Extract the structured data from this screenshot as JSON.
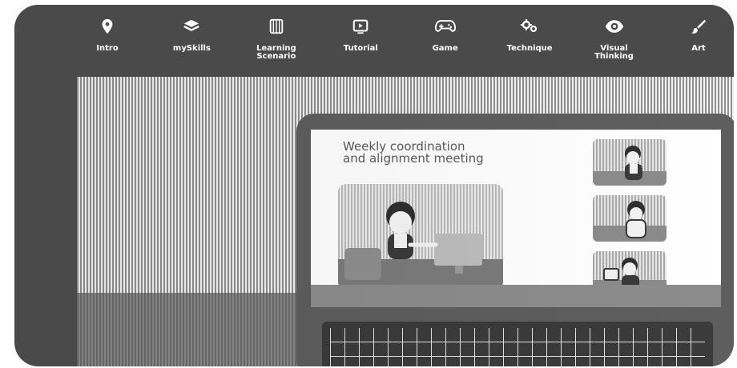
{
  "nav": {
    "items": [
      {
        "label": "Intro",
        "icon": "location-pin-icon"
      },
      {
        "label": "mySkills",
        "icon": "layers-icon"
      },
      {
        "label": "Learning\nScenario",
        "icon": "book-icon"
      },
      {
        "label": "Tutorial",
        "icon": "play-screen-icon"
      },
      {
        "label": "Game",
        "icon": "gamepad-icon"
      },
      {
        "label": "Technique",
        "icon": "gears-icon"
      },
      {
        "label": "Visual\nThinking",
        "icon": "eye-icon"
      },
      {
        "label": "Art",
        "icon": "brush-icon"
      }
    ]
  },
  "meeting": {
    "title": "Weekly coordination\nand alignment meeting"
  }
}
